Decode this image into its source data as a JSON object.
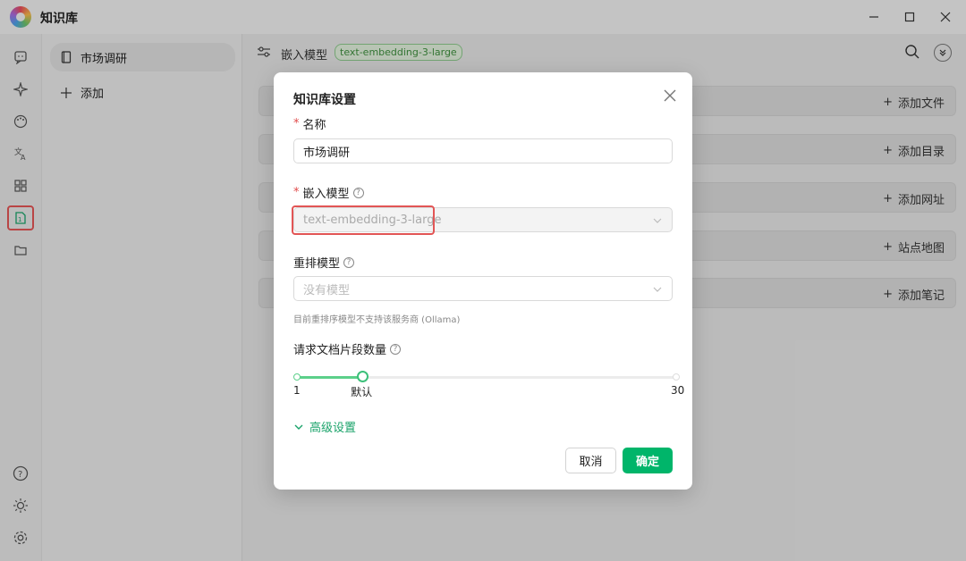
{
  "app": {
    "title": "知识库"
  },
  "rail": {
    "icons": [
      "chat-icon",
      "sparkle-icon",
      "palette-icon",
      "translate-icon",
      "apps-icon",
      "knowledge-icon",
      "folder-icon",
      "help-icon",
      "theme-icon",
      "settings-icon"
    ]
  },
  "kb_list": {
    "items": [
      {
        "label": "市场调研"
      }
    ],
    "add_label": "添加"
  },
  "main": {
    "embed_label": "嵌入模型",
    "embed_tag": "text-embedding-3-large",
    "actions": [
      {
        "label": "添加文件"
      },
      {
        "label": "添加目录"
      },
      {
        "label": "添加网址"
      },
      {
        "label": "站点地图"
      },
      {
        "label": "添加笔记"
      }
    ]
  },
  "modal": {
    "title": "知识库设置",
    "name_label": "名称",
    "name_value": "市场调研",
    "embed_label": "嵌入模型",
    "embed_value": "text-embedding-3-large",
    "rerank_label": "重排模型",
    "rerank_placeholder": "没有模型",
    "rerank_hint": "目前重排序模型不支持该服务商 (Ollama)",
    "chunks_label": "请求文档片段数量",
    "slider": {
      "min": 1,
      "max": 30,
      "value": 6,
      "min_label": "1",
      "max_label": "30",
      "default_label": "默认"
    },
    "advanced_label": "高级设置",
    "cancel_label": "取消",
    "ok_label": "确定"
  },
  "colors": {
    "accent": "#00b56a",
    "highlight": "#e25555",
    "tag_bg": "#e1efdc",
    "tag_text": "#3f8f3f"
  }
}
